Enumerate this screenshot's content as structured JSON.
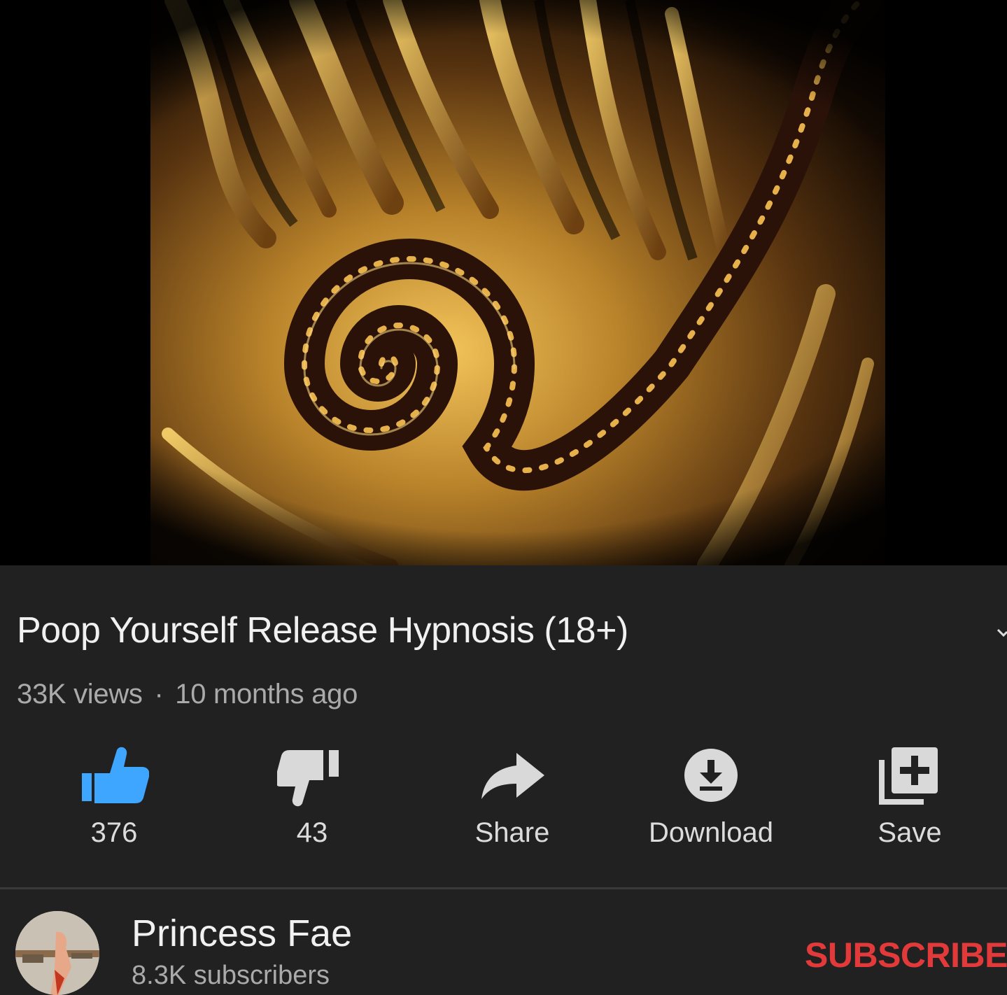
{
  "video": {
    "title": "Poop Yourself Release Hypnosis (18+)",
    "views": "33K views",
    "separator": "·",
    "age": "10 months ago",
    "progress_percent": 2.5
  },
  "actions": {
    "like": {
      "label": "376",
      "icon": "thumbs-up-icon",
      "color": "#3ea6ff"
    },
    "dislike": {
      "label": "43",
      "icon": "thumbs-down-icon"
    },
    "share": {
      "label": "Share",
      "icon": "share-arrow-icon"
    },
    "download": {
      "label": "Download",
      "icon": "download-icon"
    },
    "save": {
      "label": "Save",
      "icon": "playlist-add-icon"
    }
  },
  "channel": {
    "name": "Princess Fae",
    "subscribers": "8.3K subscribers",
    "subscribe_label": "SUBSCRIBE",
    "subscribe_color": "#e23a3a"
  },
  "colors": {
    "background": "#212121",
    "progress": "#ff0000",
    "secondary_text": "#aaaaaa"
  }
}
